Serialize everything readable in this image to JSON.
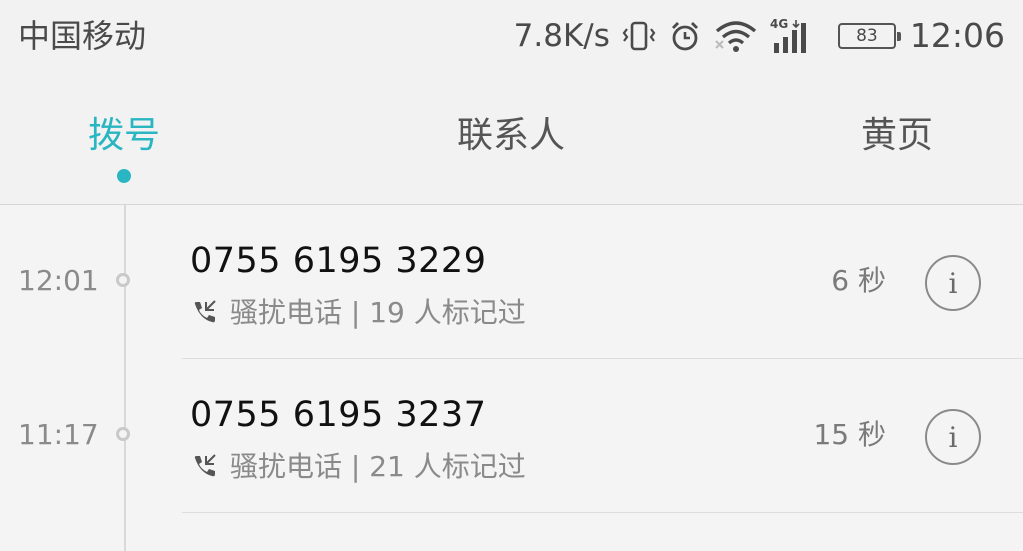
{
  "status_bar": {
    "carrier": "中国移动",
    "net_speed": "7.8K/s",
    "network_type": "4G",
    "battery": "83",
    "time": "12:06",
    "icons": [
      "vibrate-icon",
      "alarm-icon",
      "wifi-icon",
      "signal-icon",
      "battery-icon"
    ]
  },
  "tabs": [
    {
      "label": "拨号",
      "active": true
    },
    {
      "label": "联系人",
      "active": false
    },
    {
      "label": "黄页",
      "active": false
    }
  ],
  "calls": [
    {
      "time": "12:01",
      "number": "0755 6195 3229",
      "tag": "骚扰电话 | 19 人标记过",
      "duration": "6 秒"
    },
    {
      "time": "11:17",
      "number": "0755 6195 3237",
      "tag": "骚扰电话 | 21 人标记过",
      "duration": "15 秒"
    }
  ],
  "colors": {
    "accent": "#29b6c2",
    "text": "#111111",
    "secondary": "#8a8a8a"
  }
}
